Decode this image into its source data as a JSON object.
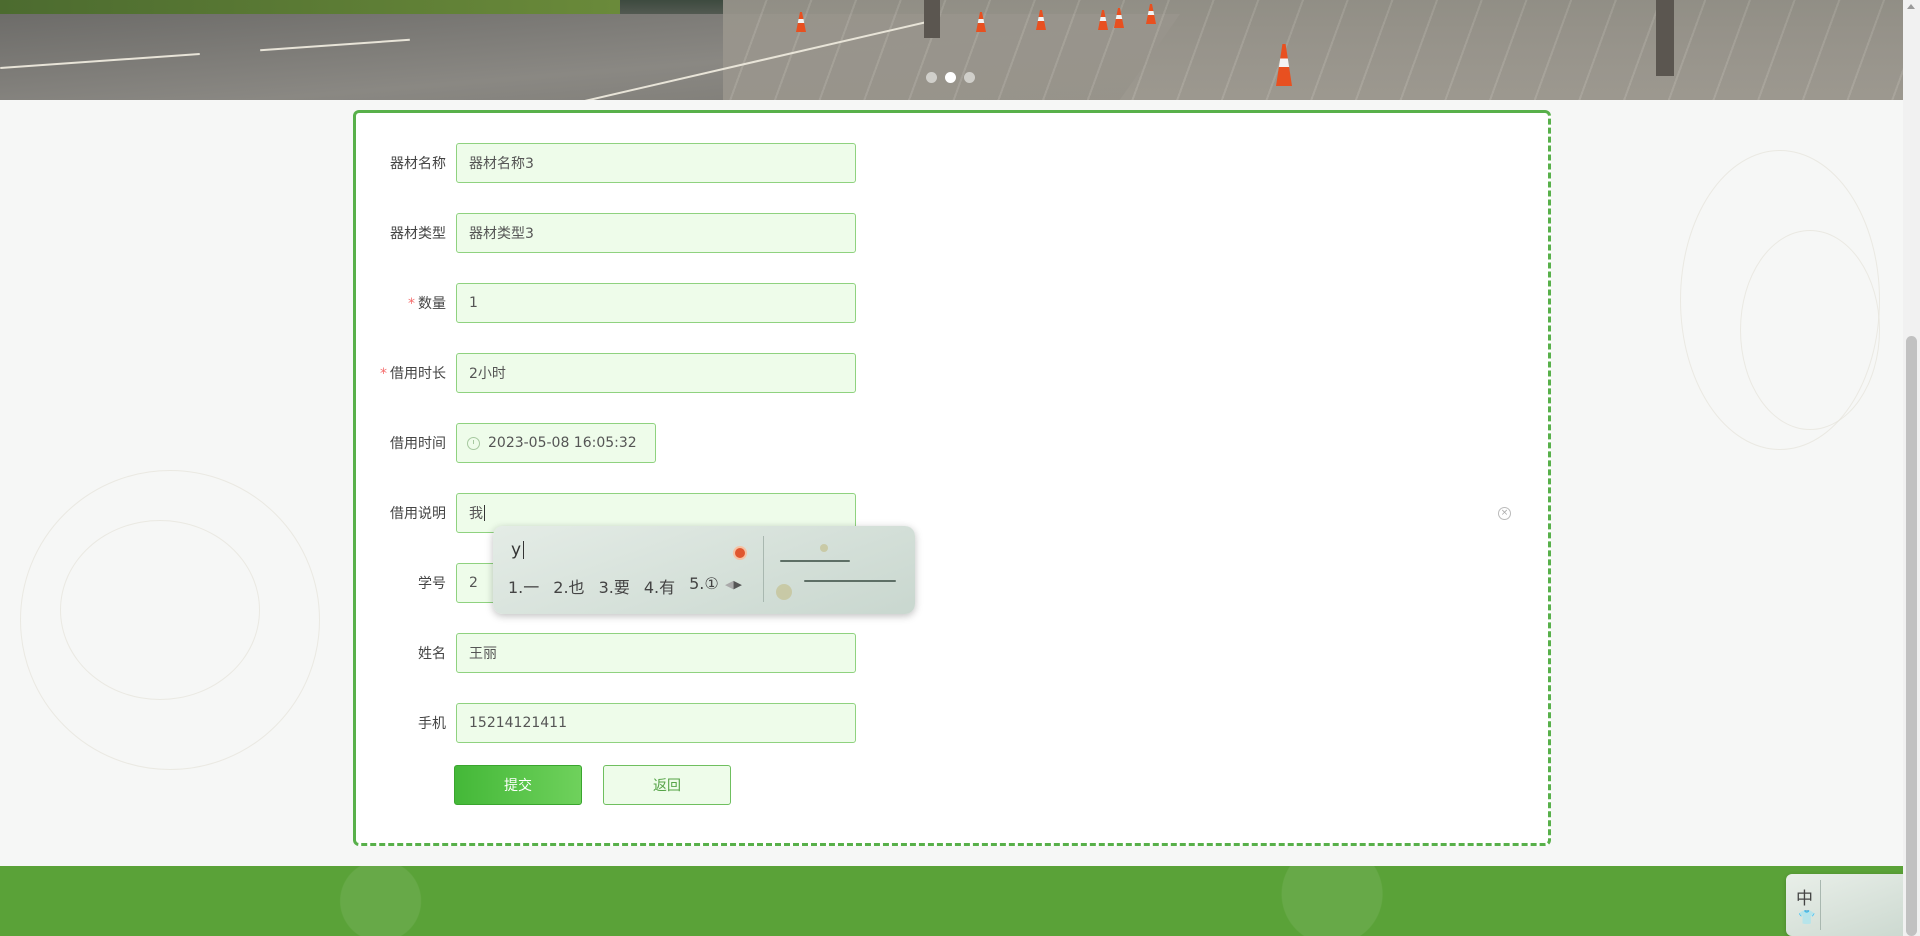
{
  "banner": {
    "active_slide": 2,
    "slide_count": 3
  },
  "form": {
    "fields": [
      {
        "label": "器材名称",
        "value": "器材名称3",
        "required": false
      },
      {
        "label": "器材类型",
        "value": "器材类型3",
        "required": false
      },
      {
        "label": "数量",
        "value": "1",
        "required": true
      },
      {
        "label": "借用时长",
        "value": "2小时",
        "required": true
      },
      {
        "label": "借用时间",
        "value": "2023-05-08 16:05:32",
        "required": false
      },
      {
        "label": "借用说明",
        "value": "我",
        "required": false
      },
      {
        "label": "学号",
        "value": "2",
        "required": false
      },
      {
        "label": "姓名",
        "value": "王丽",
        "required": false
      },
      {
        "label": "手机",
        "value": "15214121411",
        "required": false
      }
    ],
    "required_mark": "*",
    "submit_label": "提交",
    "back_label": "返回"
  },
  "ime": {
    "composition": "y",
    "candidates": [
      "1.一",
      "2.也",
      "3.要",
      "4.有",
      "5.①"
    ],
    "toolbar_mode": "中"
  },
  "colors": {
    "accent": "#58b04a",
    "input_bg": "#eefcea",
    "footer": "#5aa238"
  }
}
